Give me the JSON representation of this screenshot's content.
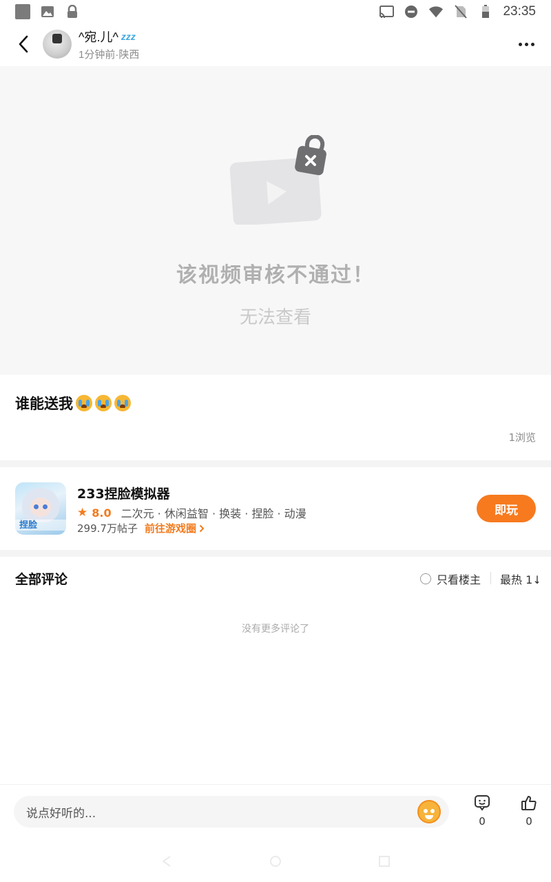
{
  "status_bar": {
    "time": "23:35",
    "left_icons": [
      "app-square-icon",
      "image-icon",
      "lock-icon"
    ],
    "right_icons": [
      "cast-icon",
      "do-not-disturb-icon",
      "wifi-icon",
      "no-sim-icon",
      "battery-icon"
    ]
  },
  "header": {
    "username": "^宛.儿^",
    "username_badge": "zzz",
    "subtitle": "1分钟前·陕西"
  },
  "video": {
    "title": "该视频审核不通过！",
    "subtitle": "无法查看"
  },
  "post": {
    "text": "谁能送我",
    "emoji_count": 3,
    "views": "1浏览"
  },
  "game": {
    "name": "233捏脸模拟器",
    "rating": "8.0",
    "tags": "二次元 · 休闲益智 · 换装 · 捏脸 · 动漫",
    "posts": "299.7万帖子",
    "circle_link": "前往游戏圈",
    "play_label": "即玩",
    "thumb_logo": "捏脸"
  },
  "comments": {
    "title": "全部评论",
    "only_owner": "只看楼主",
    "sort": "最热 1↓",
    "empty": "没有更多评论了"
  },
  "bottom": {
    "placeholder": "说点好听的...",
    "comment_count": "0",
    "like_count": "0"
  },
  "colors": {
    "accent": "#f77a1e",
    "placeholder_bg": "#f7f7f8",
    "divider": "#f4f4f5"
  }
}
